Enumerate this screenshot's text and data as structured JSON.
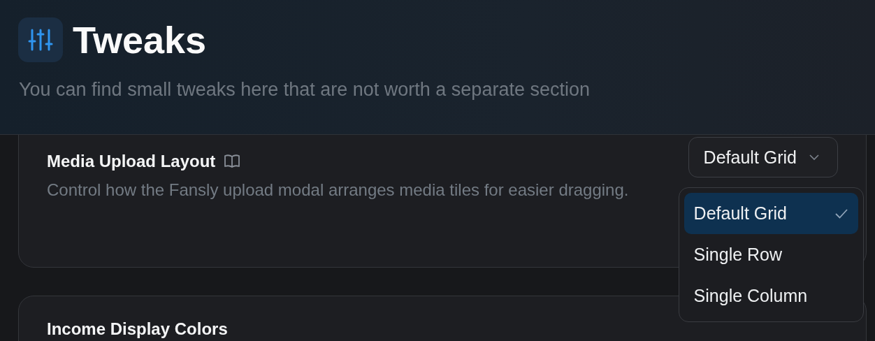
{
  "header": {
    "title": "Tweaks",
    "subtitle": "You can find small tweaks here that are not worth a separate section"
  },
  "settings": [
    {
      "title": "Media Upload Layout",
      "description": "Control how the Fansly upload modal arranges media tiles for easier dragging.",
      "select": {
        "value": "Default Grid",
        "expanded": true,
        "options": [
          {
            "label": "Default Grid",
            "selected": true
          },
          {
            "label": "Single Row",
            "selected": false
          },
          {
            "label": "Single Column",
            "selected": false
          }
        ]
      }
    },
    {
      "title": "Income Display Colors"
    }
  ]
}
